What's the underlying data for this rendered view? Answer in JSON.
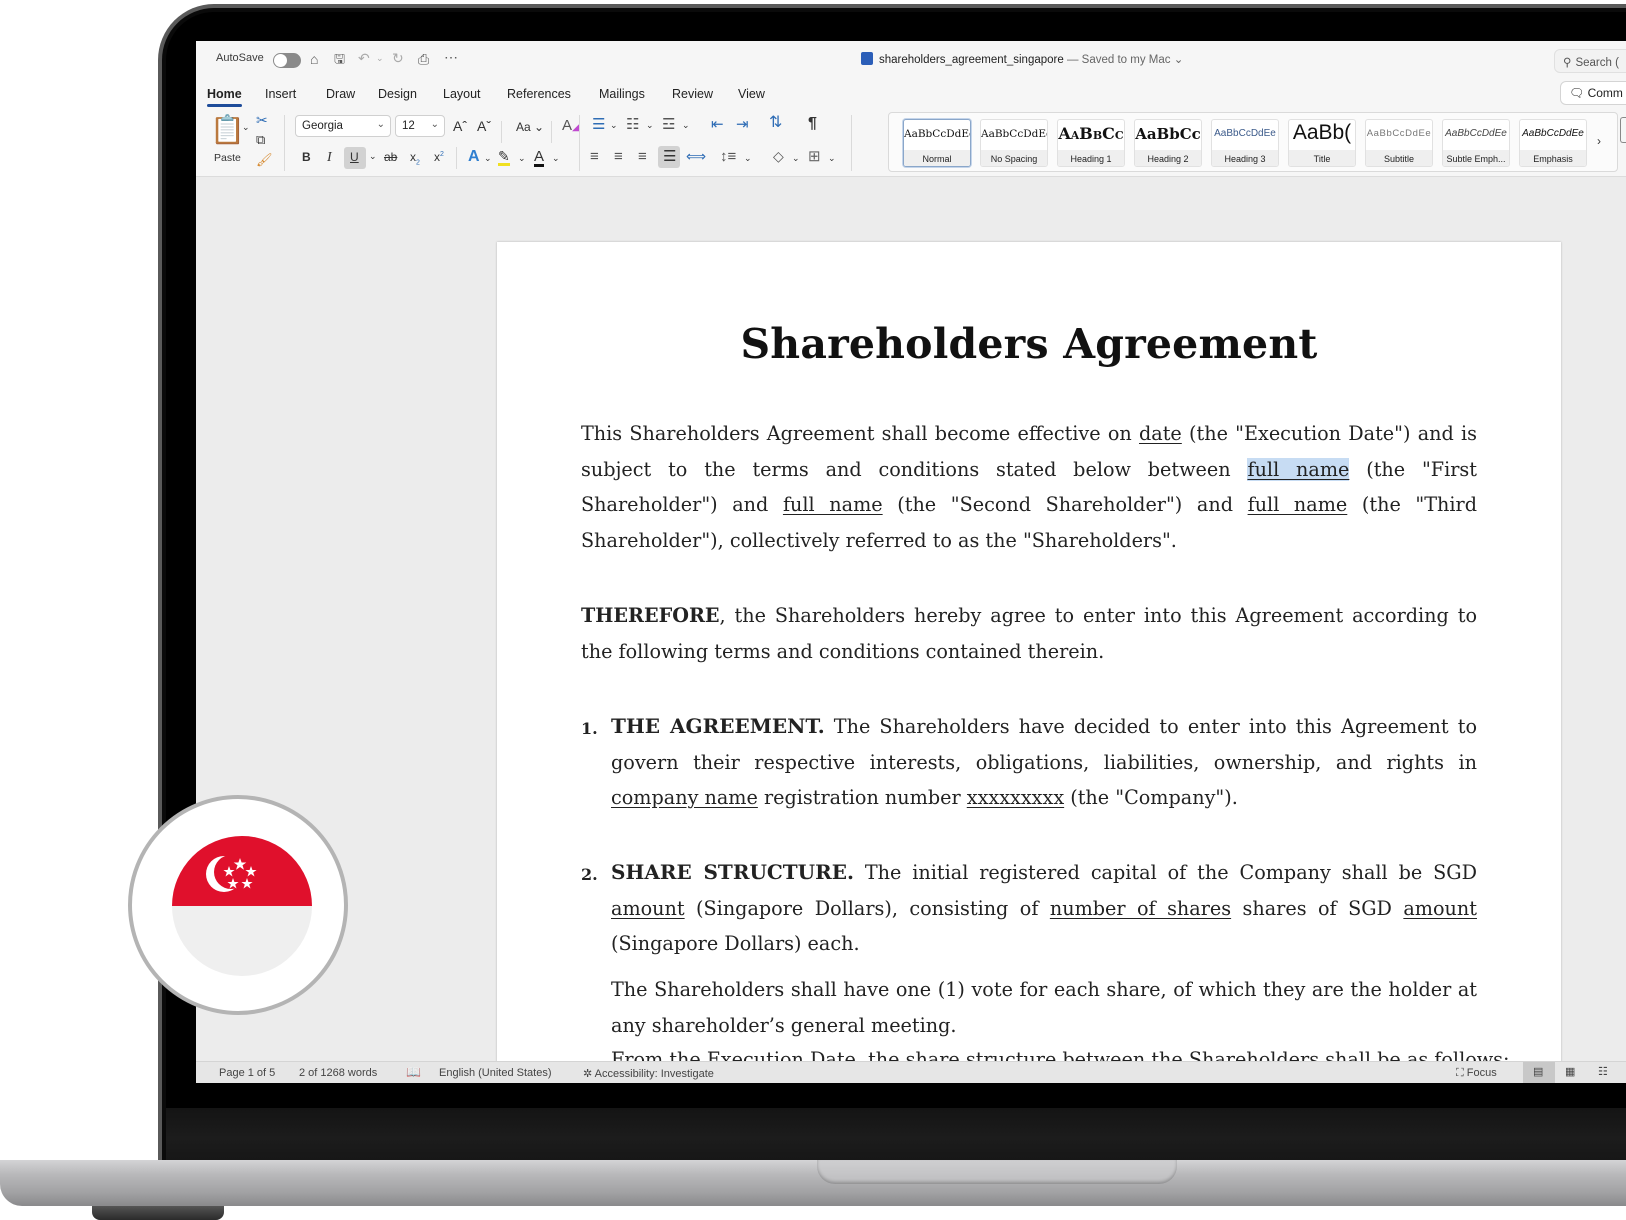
{
  "titlebar": {
    "autosave_label": "AutoSave",
    "autosave_on": false,
    "document_name": "shareholders_agreement_singapore",
    "save_status": "— Saved to my Mac",
    "search_placeholder": "Search (",
    "icons": [
      "home-icon",
      "save-icon",
      "undo-icon",
      "redo-icon",
      "print-icon",
      "more-icon"
    ]
  },
  "tabs": [
    {
      "label": "Home",
      "active": true
    },
    {
      "label": "Insert"
    },
    {
      "label": "Draw"
    },
    {
      "label": "Design"
    },
    {
      "label": "Layout"
    },
    {
      "label": "References"
    },
    {
      "label": "Mailings"
    },
    {
      "label": "Review"
    },
    {
      "label": "View"
    }
  ],
  "comments_label": "Comm",
  "ribbon": {
    "paste_label": "Paste",
    "font_name": "Georgia",
    "font_size": "12",
    "change_case_label": "Aa",
    "bold": "B",
    "italic": "I",
    "underline": "U",
    "strikethrough": "ab",
    "subscript": "x",
    "superscript": "x",
    "styles": [
      {
        "sample": "AaBbCcDdEe",
        "name": "Normal",
        "selected": true
      },
      {
        "sample": "AaBbCcDdEe",
        "name": "No Spacing"
      },
      {
        "sample": "AaBbCc",
        "name": "Heading 1"
      },
      {
        "sample": "AaBbCc",
        "name": "Heading 2"
      },
      {
        "sample": "AaBbCcDdEe",
        "name": "Heading 3"
      },
      {
        "sample": "AaBb(",
        "name": "Title"
      },
      {
        "sample": "AaBbCcDdEe",
        "name": "Subtitle"
      },
      {
        "sample": "AaBbCcDdEe",
        "name": "Subtle Emph..."
      },
      {
        "sample": "AaBbCcDdEe",
        "name": "Emphasis"
      }
    ]
  },
  "document": {
    "title": "Shareholders Agreement",
    "intro": {
      "t1": "This Shareholders Agreement shall become effective on ",
      "f_date": "date",
      "t2": " (the \"Execution Date\") and is subject to the terms and conditions stated below between ",
      "f_name1": "full name",
      "t3": " (the \"First Shareholder\") and ",
      "f_name2": "full name",
      "t4": " (the \"Second Shareholder\") and ",
      "f_name3": "full name",
      "t5": " (the \"Third Shareholder\"), collectively referred to as the \"Shareholders\"."
    },
    "therefore": {
      "bold": "THEREFORE",
      "text": ", the Shareholders hereby agree to enter into this Agreement according to the following terms and conditions contained therein."
    },
    "section1": {
      "number": "1.",
      "heading": "THE AGREEMENT.",
      "t1": " The Shareholders have decided to enter into this Agreement to govern their respective interests, obligations, liabilities, ownership, and rights in ",
      "f_company": "company name",
      "t2": " registration number ",
      "f_reg": "xxxxxxxxx",
      "t3": " (the \"Company\")."
    },
    "section2": {
      "number": "2.",
      "heading": "SHARE STRUCTURE.",
      "t1": " The initial registered capital of the Company shall be SGD ",
      "f_amount1": "amount",
      "t2": " (Singapore Dollars), consisting of ",
      "f_shares": "number of shares",
      "t3": " shares of SGD ",
      "f_amount2": "amount",
      "t4": " (Singapore Dollars) each.",
      "p2": "The Shareholders shall have one (1) vote for each share, of which they are the holder at any shareholder’s general meeting.",
      "p3": "From the Execution Date, the share structure between the Shareholders shall be as follows:"
    }
  },
  "statusbar": {
    "page": "Page 1 of 5",
    "words": "2 of 1268 words",
    "language": "English (United States)",
    "accessibility": "Accessibility: Investigate",
    "focus": "Focus"
  },
  "badge": {
    "country": "Singapore",
    "flag_red": "#e0102c",
    "flag_white": "#efefef"
  }
}
